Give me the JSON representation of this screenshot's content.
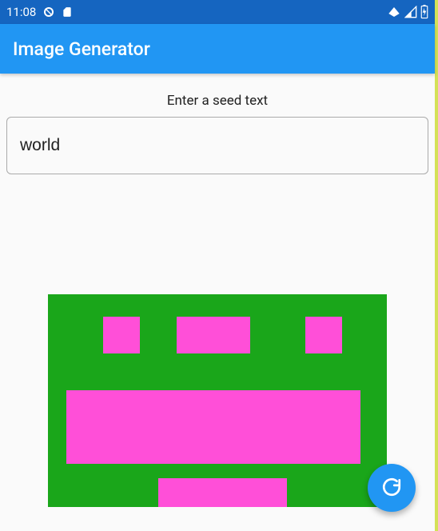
{
  "status_bar": {
    "time": "11:08",
    "left_icons": [
      "no-sign-icon",
      "sd-card-icon"
    ],
    "right_icons": [
      "wifi-icon",
      "signal-icon",
      "battery-charging-icon"
    ]
  },
  "app_bar": {
    "title": "Image Generator"
  },
  "prompt": {
    "label": "Enter a seed text",
    "value": "world",
    "placeholder": ""
  },
  "image": {
    "bg_color": "#1aa61a",
    "fg_color": "#ff4fd8",
    "cell": 46,
    "cols": 9,
    "rows": 6,
    "pixels": [
      [
        1.5,
        0.6,
        1,
        1
      ],
      [
        3.5,
        0.6,
        2,
        1
      ],
      [
        7,
        0.6,
        1,
        1
      ],
      [
        0.5,
        2.6,
        8,
        2
      ],
      [
        3,
        5,
        3.5,
        1
      ]
    ]
  },
  "fab": {
    "icon": "refresh-icon"
  }
}
